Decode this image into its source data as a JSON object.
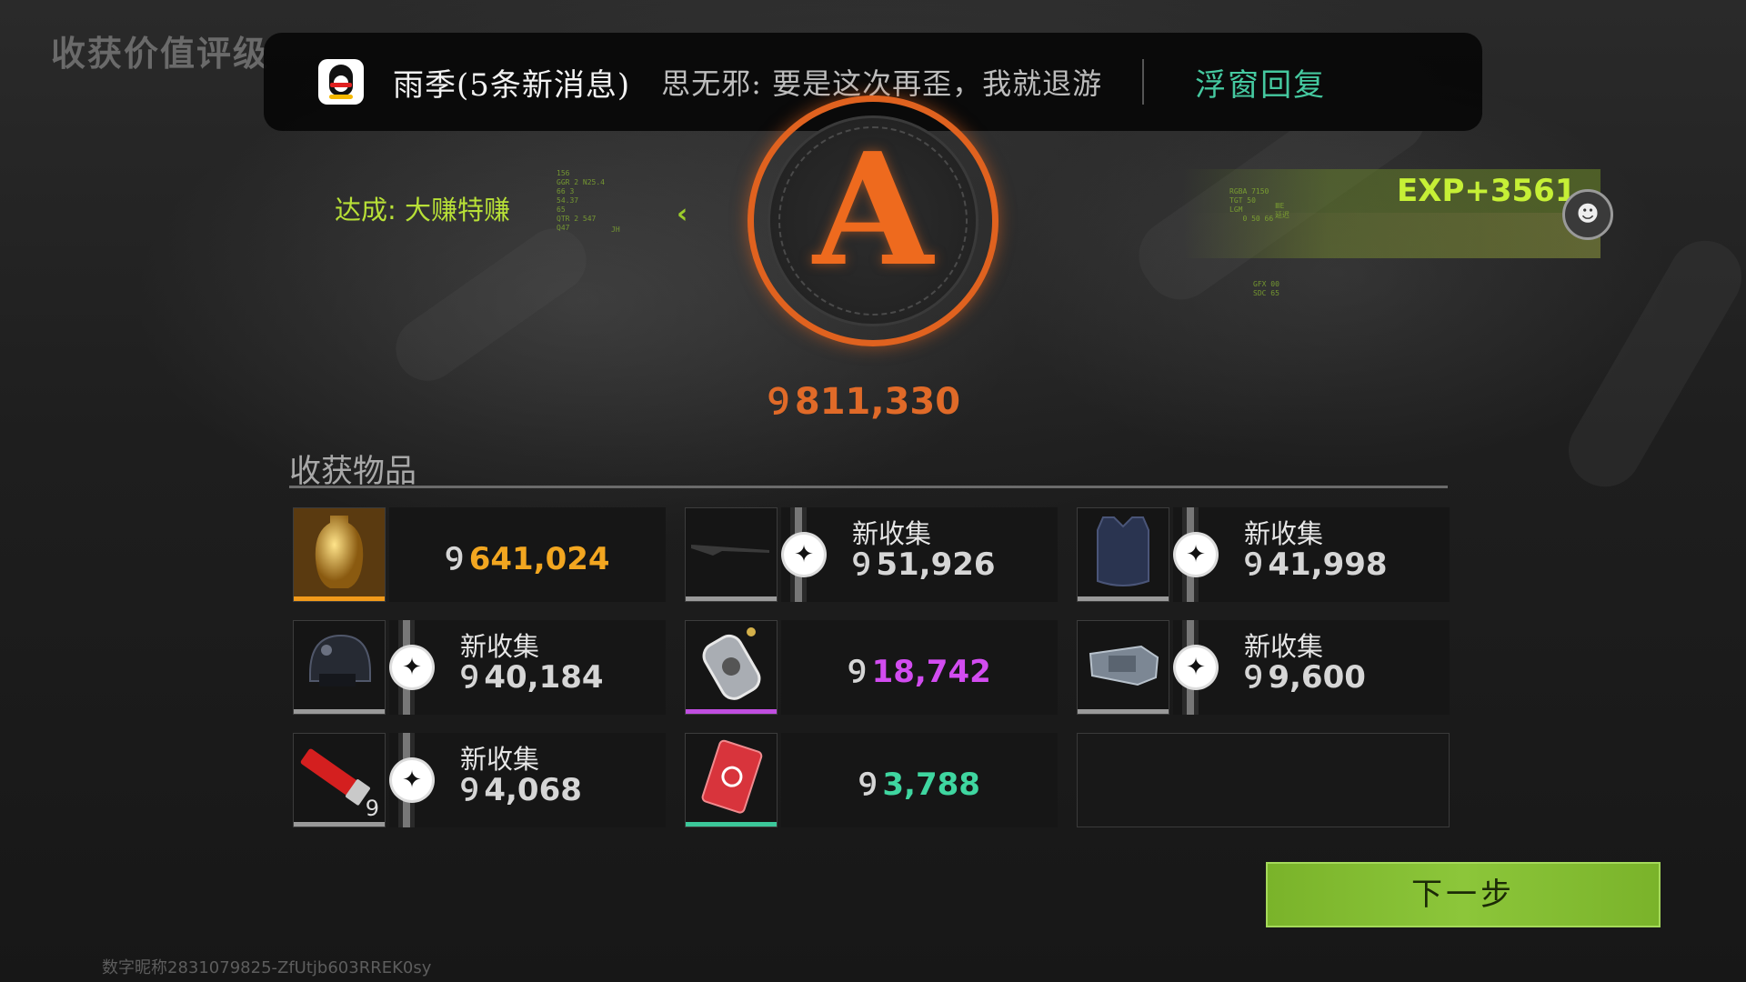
{
  "page": {
    "title": "收获价值评级"
  },
  "notification": {
    "sender": "雨季(5条新消息)",
    "message": "思无邪: 要是这次再歪，我就退游",
    "reply": "浮窗回复"
  },
  "result": {
    "achievement": "达成: 大赚特赚",
    "grade": "A",
    "total_value": "811,330",
    "exp": "EXP+3561"
  },
  "hud": {
    "left_block": "156\nGGR 2 N25.4\n66 3\n54.37\n65\nQTR 2 547\nQ47",
    "left_small": "JH",
    "right_block": "RGBA 7150\nTGT 50\nLGM\n   0 50 66",
    "right_tags": "ⅢE\n延迟",
    "right_bottom": "GFX 00\nSDC 65"
  },
  "items_section": {
    "title": "收获物品"
  },
  "items": [
    {
      "value": "641,024",
      "is_new": false,
      "new_label": "",
      "value_color": "#f2a620",
      "rarity_color": "#f29a1a",
      "icon": "golden-vase-icon",
      "count": ""
    },
    {
      "value": "51,926",
      "is_new": true,
      "new_label": "新收集",
      "value_color": "#d6d6d6",
      "rarity_color": "#9a9a9a",
      "icon": "rifle-icon",
      "count": ""
    },
    {
      "value": "41,998",
      "is_new": true,
      "new_label": "新收集",
      "value_color": "#d6d6d6",
      "rarity_color": "#9a9a9a",
      "icon": "body-armor-icon",
      "count": ""
    },
    {
      "value": "40,184",
      "is_new": true,
      "new_label": "新收集",
      "value_color": "#d6d6d6",
      "rarity_color": "#9a9a9a",
      "icon": "helmet-icon",
      "count": ""
    },
    {
      "value": "18,742",
      "is_new": false,
      "new_label": "",
      "value_color": "#d24cf0",
      "rarity_color": "#c04ee0",
      "icon": "dog-tag-icon",
      "count": ""
    },
    {
      "value": "9,600",
      "is_new": true,
      "new_label": "新收集",
      "value_color": "#d6d6d6",
      "rarity_color": "#9a9a9a",
      "icon": "arm-guard-icon",
      "count": ""
    },
    {
      "value": "4,068",
      "is_new": true,
      "new_label": "新收集",
      "value_color": "#d6d6d6",
      "rarity_color": "#9a9a9a",
      "icon": "shotgun-shell-icon",
      "count": "9"
    },
    {
      "value": "3,788",
      "is_new": false,
      "new_label": "",
      "value_color": "#3fd6a0",
      "rarity_color": "#3cc89a",
      "icon": "playing-card-icon",
      "count": ""
    }
  ],
  "currency_symbol": "Ꝯ",
  "next_button": "下一步",
  "footer": {
    "user_id": "数字昵称2831079825-ZfUtjb603RREK0sy"
  }
}
